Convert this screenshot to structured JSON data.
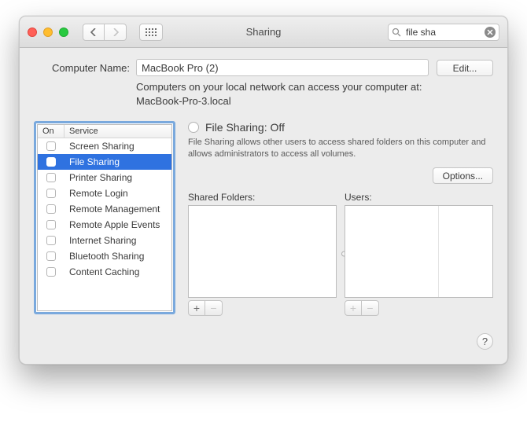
{
  "window": {
    "title": "Sharing"
  },
  "search": {
    "placeholder": "Search",
    "value": "file sha"
  },
  "computer_name": {
    "label": "Computer Name:",
    "value": "MacBook Pro (2)",
    "hint_line1": "Computers on your local network can access your computer at:",
    "hint_line2": "MacBook-Pro-3.local",
    "edit_label": "Edit..."
  },
  "services": {
    "header_on": "On",
    "header_service": "Service",
    "items": [
      {
        "label": "Screen Sharing",
        "on": false,
        "selected": false
      },
      {
        "label": "File Sharing",
        "on": false,
        "selected": true
      },
      {
        "label": "Printer Sharing",
        "on": false,
        "selected": false
      },
      {
        "label": "Remote Login",
        "on": false,
        "selected": false
      },
      {
        "label": "Remote Management",
        "on": false,
        "selected": false
      },
      {
        "label": "Remote Apple Events",
        "on": false,
        "selected": false
      },
      {
        "label": "Internet Sharing",
        "on": false,
        "selected": false
      },
      {
        "label": "Bluetooth Sharing",
        "on": false,
        "selected": false
      },
      {
        "label": "Content Caching",
        "on": false,
        "selected": false
      }
    ]
  },
  "detail": {
    "status_label": "File Sharing: Off",
    "description": "File Sharing allows other users to access shared folders on this computer and allows administrators to access all volumes.",
    "options_label": "Options...",
    "shared_folders_label": "Shared Folders:",
    "users_label": "Users:"
  },
  "buttons": {
    "plus": "+",
    "minus": "−",
    "help": "?"
  }
}
